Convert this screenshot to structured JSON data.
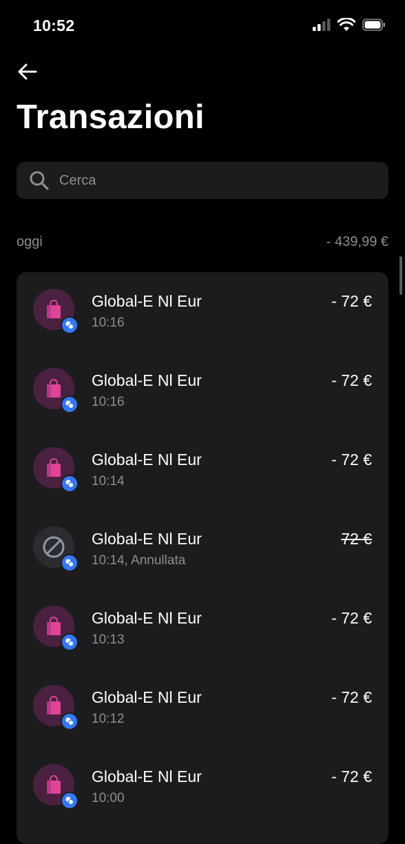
{
  "status_bar": {
    "time": "10:52"
  },
  "header": {
    "title": "Transazioni"
  },
  "search": {
    "placeholder": "Cerca"
  },
  "section": {
    "label": "oggi",
    "total": "- 439,99 €"
  },
  "transactions": [
    {
      "merchant": "Global-E Nl Eur",
      "subtitle": "10:16",
      "amount": "- 72 €",
      "icon": "shopping-bag-icon"
    },
    {
      "merchant": "Global-E Nl Eur",
      "subtitle": "10:16",
      "amount": "- 72 €",
      "icon": "shopping-bag-icon"
    },
    {
      "merchant": "Global-E Nl Eur",
      "subtitle": "10:14",
      "amount": "- 72 €",
      "icon": "shopping-bag-icon"
    },
    {
      "merchant": "Global-E Nl Eur",
      "subtitle": "10:14, Annullata",
      "amount": "72 €",
      "icon": "cancelled-icon"
    },
    {
      "merchant": "Global-E Nl Eur",
      "subtitle": "10:13",
      "amount": "- 72 €",
      "icon": "shopping-bag-icon"
    },
    {
      "merchant": "Global-E Nl Eur",
      "subtitle": "10:12",
      "amount": "- 72 €",
      "icon": "shopping-bag-icon"
    },
    {
      "merchant": "Global-E Nl Eur",
      "subtitle": "10:00",
      "amount": "- 72 €",
      "icon": "shopping-bag-icon"
    }
  ],
  "colors": {
    "background": "#000000",
    "card": "#1c1c1e",
    "secondary_text": "#8e8e93",
    "badge": "#3478f6",
    "bag_avatar": "#4a2140",
    "bag": "#e0449a"
  }
}
